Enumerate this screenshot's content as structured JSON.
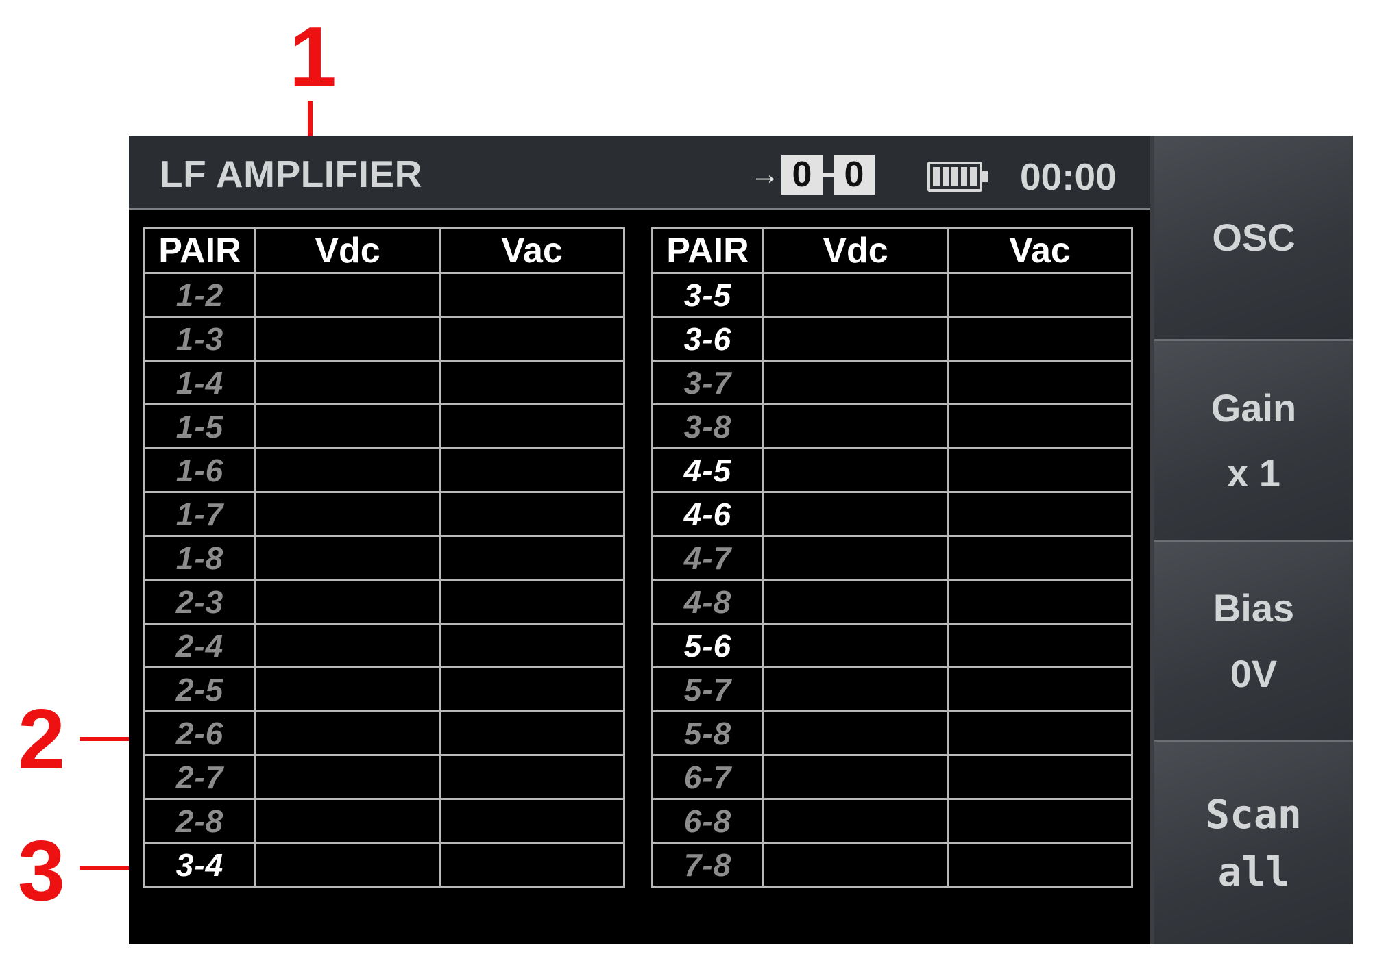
{
  "callouts": [
    "1",
    "2",
    "3"
  ],
  "status_bar": {
    "title": "LF AMPLIFIER",
    "arrow_icon": "→",
    "counter_a": "0",
    "counter_b": "0",
    "battery_icon": "battery-full-icon",
    "time": "00:00"
  },
  "table_headers": [
    "PAIR",
    "Vdc",
    "Vac"
  ],
  "left_table": [
    {
      "pair": "1-2",
      "vdc": "",
      "vac": "",
      "active": false
    },
    {
      "pair": "1-3",
      "vdc": "",
      "vac": "",
      "active": false
    },
    {
      "pair": "1-4",
      "vdc": "",
      "vac": "",
      "active": false
    },
    {
      "pair": "1-5",
      "vdc": "",
      "vac": "",
      "active": false
    },
    {
      "pair": "1-6",
      "vdc": "",
      "vac": "",
      "active": false
    },
    {
      "pair": "1-7",
      "vdc": "",
      "vac": "",
      "active": false
    },
    {
      "pair": "1-8",
      "vdc": "",
      "vac": "",
      "active": false
    },
    {
      "pair": "2-3",
      "vdc": "",
      "vac": "",
      "active": false
    },
    {
      "pair": "2-4",
      "vdc": "",
      "vac": "",
      "active": false
    },
    {
      "pair": "2-5",
      "vdc": "",
      "vac": "",
      "active": false
    },
    {
      "pair": "2-6",
      "vdc": "",
      "vac": "",
      "active": false
    },
    {
      "pair": "2-7",
      "vdc": "",
      "vac": "",
      "active": false
    },
    {
      "pair": "2-8",
      "vdc": "",
      "vac": "",
      "active": false
    },
    {
      "pair": "3-4",
      "vdc": "",
      "vac": "",
      "active": true
    }
  ],
  "right_table": [
    {
      "pair": "3-5",
      "vdc": "",
      "vac": "",
      "active": true
    },
    {
      "pair": "3-6",
      "vdc": "",
      "vac": "",
      "active": true
    },
    {
      "pair": "3-7",
      "vdc": "",
      "vac": "",
      "active": false
    },
    {
      "pair": "3-8",
      "vdc": "",
      "vac": "",
      "active": false
    },
    {
      "pair": "4-5",
      "vdc": "",
      "vac": "",
      "active": true
    },
    {
      "pair": "4-6",
      "vdc": "",
      "vac": "",
      "active": true
    },
    {
      "pair": "4-7",
      "vdc": "",
      "vac": "",
      "active": false
    },
    {
      "pair": "4-8",
      "vdc": "",
      "vac": "",
      "active": false
    },
    {
      "pair": "5-6",
      "vdc": "",
      "vac": "",
      "active": true
    },
    {
      "pair": "5-7",
      "vdc": "",
      "vac": "",
      "active": false
    },
    {
      "pair": "5-8",
      "vdc": "",
      "vac": "",
      "active": false
    },
    {
      "pair": "6-7",
      "vdc": "",
      "vac": "",
      "active": false
    },
    {
      "pair": "6-8",
      "vdc": "",
      "vac": "",
      "active": false
    },
    {
      "pair": "7-8",
      "vdc": "",
      "vac": "",
      "active": false
    }
  ],
  "softkeys": [
    {
      "line1": "OSC",
      "line2": ""
    },
    {
      "line1": "Gain",
      "line2": "x 1"
    },
    {
      "line1": "Bias",
      "line2": "0V"
    },
    {
      "line1": "Scan",
      "line2": "all"
    }
  ],
  "colors": {
    "callout": "#ee1111",
    "active_pair": "#ffffff",
    "inactive_pair": "#8c8c8c",
    "status_bar_bg": "#2a2e33"
  }
}
